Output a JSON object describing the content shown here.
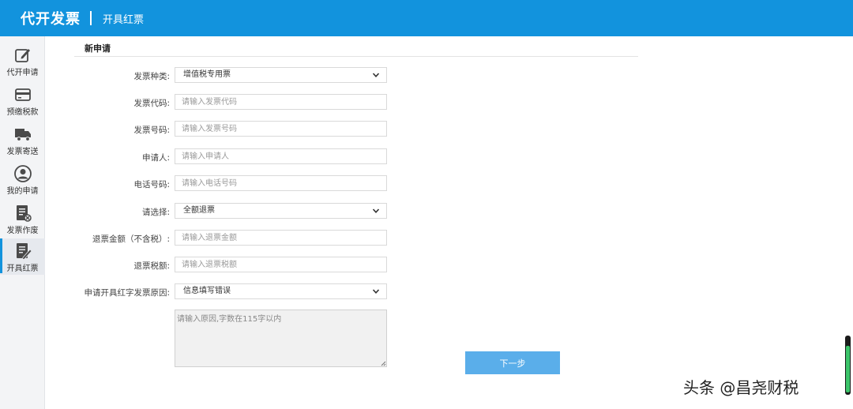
{
  "header": {
    "app_title": "代开发票",
    "page_title": "开具红票"
  },
  "sidebar": {
    "items": [
      {
        "label": "代开申请",
        "icon": "edit-icon"
      },
      {
        "label": "预缴税款",
        "icon": "card-icon"
      },
      {
        "label": "发票寄送",
        "icon": "truck-icon"
      },
      {
        "label": "我的申请",
        "icon": "user-icon"
      },
      {
        "label": "发票作废",
        "icon": "invoice-void-icon"
      },
      {
        "label": "开具红票",
        "icon": "invoice-pen-icon",
        "active": true
      }
    ]
  },
  "form": {
    "section_title": "新申请",
    "invoice_type": {
      "label": "发票种类:",
      "value": "增值税专用票"
    },
    "invoice_code": {
      "label": "发票代码:",
      "placeholder": "请输入发票代码"
    },
    "invoice_number": {
      "label": "发票号码:",
      "placeholder": "请输入发票号码"
    },
    "applicant": {
      "label": "申请人:",
      "placeholder": "请输入申请人"
    },
    "phone": {
      "label": "电话号码:",
      "placeholder": "请输入电话号码"
    },
    "choice": {
      "label": "请选择:",
      "value": "全额退票"
    },
    "refund_amount": {
      "label": "退票金额（不含税）:",
      "placeholder": "请输入退票金额"
    },
    "refund_tax": {
      "label": "退票税额:",
      "placeholder": "请输入退票税额"
    },
    "red_reason": {
      "label": "申请开具红字发票原因:",
      "value": "信息填写错误"
    },
    "reason_text": {
      "placeholder": "请输入原因,字数在115字以内"
    },
    "next_button": "下一步"
  },
  "watermark": "头条 @昌尧财税",
  "scroll_indicator": {
    "level": 0.85,
    "color": "#3cc56a"
  },
  "colors": {
    "brand": "#1293dd",
    "button": "#5aaeea"
  }
}
